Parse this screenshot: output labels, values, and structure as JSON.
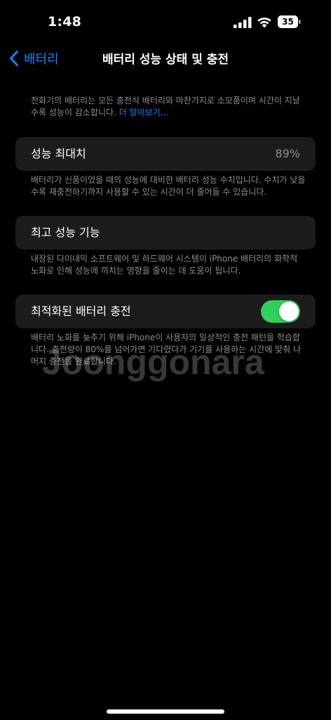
{
  "status_bar": {
    "time": "1:48",
    "battery_level": "35",
    "battery_fraction": 0.35,
    "icons": [
      "cellular-signal-icon",
      "wifi-icon",
      "battery-icon"
    ]
  },
  "nav": {
    "back_label": "배터리",
    "back_icon": "chevron-left-icon",
    "title": "배터리 성능 상태 및 충전"
  },
  "intro": {
    "text": "전화기의 배터리는 모든 충전식 배터리와 마찬가지로 소모품이며 시간이 지날수록 성능이 감소합니다.",
    "link": "더 알아보기..."
  },
  "max_capacity": {
    "label": "성능 최대치",
    "value": "89%",
    "footnote": "배터리가 신품이었을 때의 성능에 대비한 배터리 성능 수치입니다. 수치가 낮을수록 재충전하기까지 사용할 수 있는 시간이 더 줄어들 수 있습니다."
  },
  "peak_performance": {
    "label": "최고 성능 기능",
    "footnote": "내장된 다이내믹 소프트웨어 및 하드웨어 시스템이 iPhone 배터리의 화학적 노화로 인해 성능에 끼치는 영향을 줄이는 데 도움이 됩니다."
  },
  "optimized_charging": {
    "label": "최적화된 배터리 충전",
    "enabled": true,
    "footnote": "배터리 노화를 늦추기 위해 iPhone이 사용자의 일상적인 충전 패턴을 학습합니다. 충전량이 80%를 넘어가면 기다렸다가 기기를 사용하는 시간에 맞춰 나머지 충전을 완료합니다."
  },
  "watermark": "Joonggonara",
  "colors": {
    "background": "#000000",
    "group_background": "#1c1c1e",
    "accent_blue": "#0a84ff",
    "toggle_on": "#30d158",
    "secondary_text": "#8e8e93"
  }
}
